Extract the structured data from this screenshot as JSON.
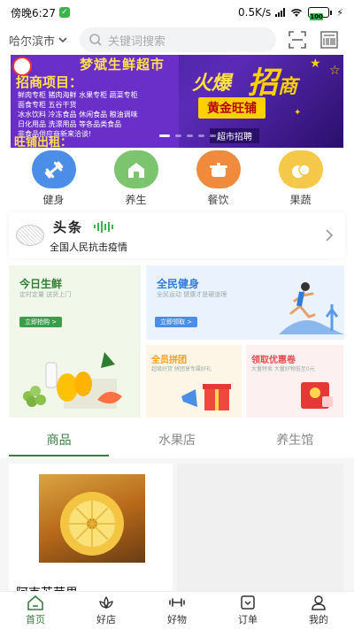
{
  "status_bar": {
    "time": "傍晚6:27",
    "network_speed": "0.5K/s",
    "battery": "100",
    "notification_icon": "wechat-icon"
  },
  "top_bar": {
    "city": "哈尔滨市",
    "search_placeholder": "关键词搜索",
    "scan_icon": "scan-icon",
    "qrcode_icon": "qrcode-icon"
  },
  "banner": {
    "brand": "梦斌生鲜超市",
    "title": "招商项目：",
    "lines": [
      "鲜肉专柜 猪肉海鲜 水果专柜 蔬菜专柜",
      "面食专柜 五谷干货",
      "冰水饮料 冷冻食品 休闲食品 粮油调味",
      "日化用品 洗漂用品 等各品类食品",
      "非食品供应商新来洽谈!"
    ],
    "rent_text": "旺铺出租：",
    "hot_text": "火爆",
    "hot_big": "招",
    "hot_tail": "商",
    "gold_label": "黄金旺铺",
    "recruit_label": "超市招聘"
  },
  "categories": [
    {
      "label": "健身",
      "icon": "dumbbell-icon",
      "color": "#4a8ee8"
    },
    {
      "label": "养生",
      "icon": "house-icon",
      "color": "#7cc46e"
    },
    {
      "label": "餐饮",
      "icon": "pot-icon",
      "color": "#f08a3c"
    },
    {
      "label": "果蔬",
      "icon": "fruit-icon",
      "color": "#f5c84a"
    }
  ],
  "headlines": {
    "title": "头条",
    "text": "全国人民抗击疫情"
  },
  "promos": {
    "fresh": {
      "title": "今日生鲜",
      "sub": "定时定量 送货上门",
      "button": "立即抢购 >"
    },
    "fitness": {
      "title": "全民健身",
      "sub": "全民运动 健康才是硬道理",
      "button": "立即领取 >"
    },
    "group": {
      "title": "全员拼团",
      "sub": "超级好货 拼团享专属好礼"
    },
    "coupon": {
      "title": "领取优惠卷",
      "sub": "大量特卖 大量好物低至0元"
    }
  },
  "tabs": [
    {
      "label": "商品",
      "active": true
    },
    {
      "label": "水果店",
      "active": false
    },
    {
      "label": "养生馆",
      "active": false
    }
  ],
  "products": [
    {
      "name": "阿克苏苹果"
    }
  ],
  "bottom_nav": [
    {
      "label": "首页",
      "icon": "home-icon",
      "active": true
    },
    {
      "label": "好店",
      "icon": "lotus-icon",
      "active": false
    },
    {
      "label": "好物",
      "icon": "dumbbell-icon",
      "active": false
    },
    {
      "label": "订单",
      "icon": "order-icon",
      "active": false
    },
    {
      "label": "我的",
      "icon": "user-icon",
      "active": false
    }
  ],
  "colors": {
    "accent": "#3a7d3f",
    "green_badge": "#3bb54a"
  }
}
